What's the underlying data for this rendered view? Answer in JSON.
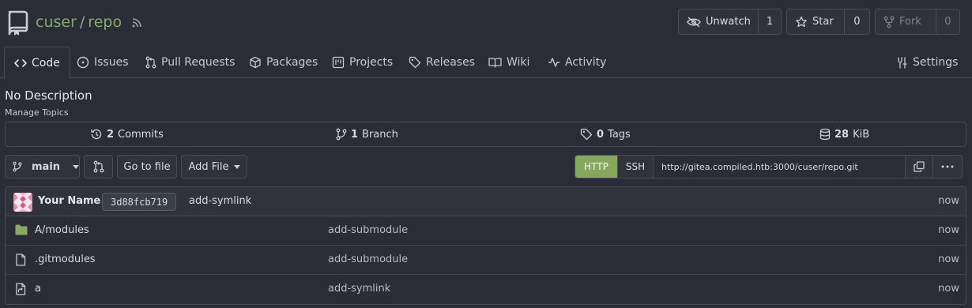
{
  "header": {
    "owner": "cuser",
    "separator": "/",
    "repo": "repo",
    "watch": {
      "label": "Unwatch",
      "count": "1"
    },
    "star": {
      "label": "Star",
      "count": "0"
    },
    "fork": {
      "label": "Fork",
      "count": "0"
    }
  },
  "tabs": [
    {
      "label": "Code",
      "icon": "code-icon"
    },
    {
      "label": "Issues",
      "icon": "issue-icon"
    },
    {
      "label": "Pull Requests",
      "icon": "pull-request-icon"
    },
    {
      "label": "Packages",
      "icon": "package-icon"
    },
    {
      "label": "Projects",
      "icon": "project-icon"
    },
    {
      "label": "Releases",
      "icon": "tag-icon"
    },
    {
      "label": "Wiki",
      "icon": "book-icon"
    },
    {
      "label": "Activity",
      "icon": "pulse-icon"
    },
    {
      "label": "Settings",
      "icon": "tools-icon"
    }
  ],
  "repo": {
    "description": "No Description",
    "manage_topics": "Manage Topics"
  },
  "stats": {
    "commits_count": "2",
    "commits_label": "Commits",
    "branches_count": "1",
    "branches_label": "Branch",
    "tags_count": "0",
    "tags_label": "Tags",
    "size_value": "28",
    "size_unit": "KiB"
  },
  "toolbar": {
    "branch": "main",
    "go_to_file": "Go to file",
    "add_file": "Add File"
  },
  "clone": {
    "http": "HTTP",
    "ssh": "SSH",
    "url": "http://gitea.compiled.htb:3000/cuser/repo.git"
  },
  "latest_commit": {
    "author": "Your Name",
    "sha": "3d88fcb719",
    "message": "add-symlink",
    "time": "now"
  },
  "files": [
    {
      "name": "A/modules",
      "type": "folder",
      "message": "add-submodule",
      "time": "now"
    },
    {
      "name": ".gitmodules",
      "type": "file",
      "message": "add-submodule",
      "time": "now"
    },
    {
      "name": "a",
      "type": "symlink",
      "message": "add-symlink",
      "time": "now"
    }
  ],
  "colors": {
    "background": "#2a2d36",
    "accent_green": "#87ab63",
    "http_active": "#86a85d",
    "border": "#454a53"
  }
}
